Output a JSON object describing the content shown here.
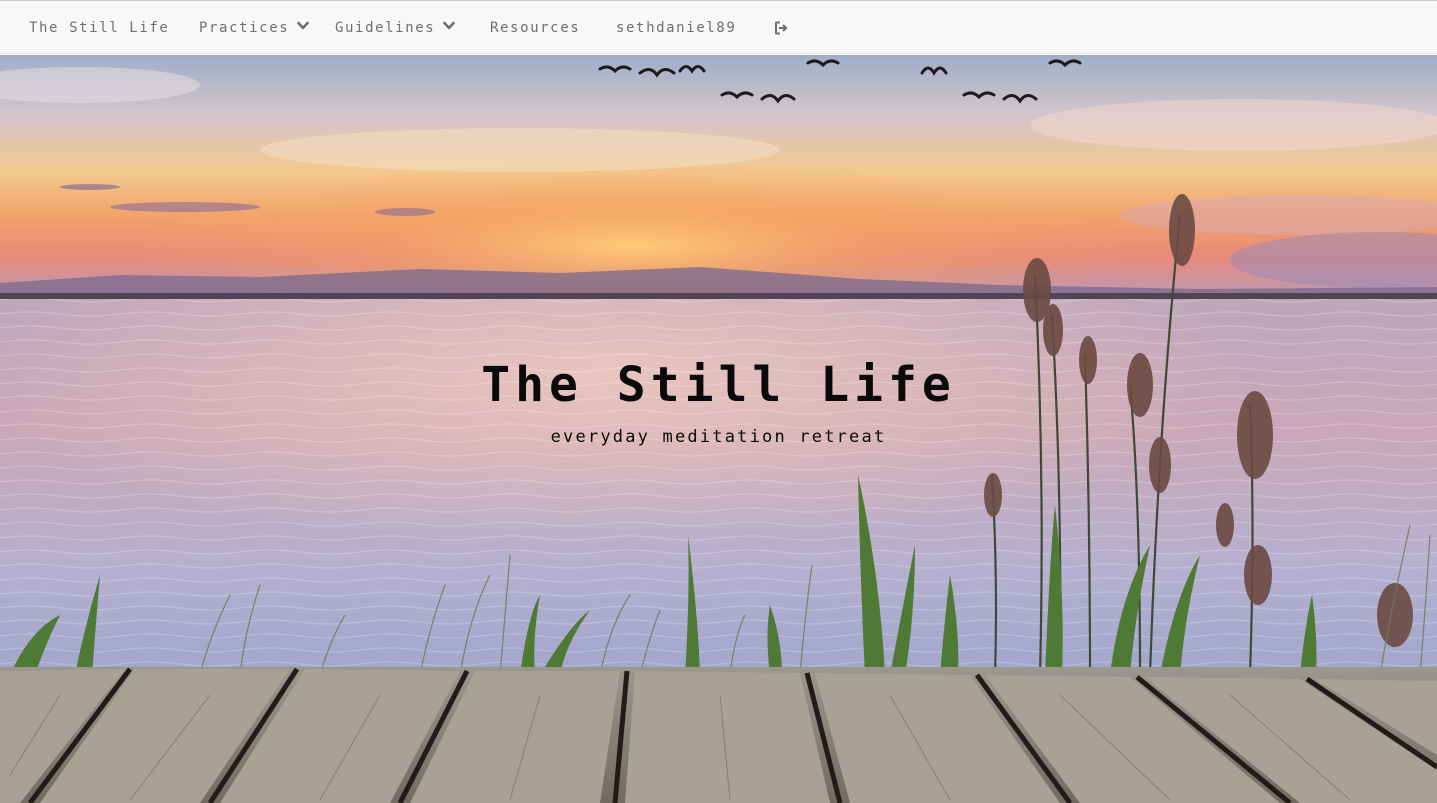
{
  "navbar": {
    "brand": "The Still Life",
    "items": [
      {
        "label": "Practices",
        "has_dropdown": true,
        "icon": "chevron-down-icon"
      },
      {
        "label": "Guidelines",
        "has_dropdown": true,
        "icon": "chevron-down-icon"
      },
      {
        "label": "Resources",
        "has_dropdown": false
      },
      {
        "label": "sethdaniel89",
        "has_dropdown": false
      }
    ],
    "logout_icon": "sign-out-icon"
  },
  "hero": {
    "title": "The Still Life",
    "tagline": "everyday meditation retreat",
    "background": "sunset-lake-with-reeds-and-wooden-dock"
  },
  "colors": {
    "nav_bg": "#f8f8f8",
    "nav_text": "#6f6f6f",
    "hero_text": "#0a0a0a",
    "sky_top": "#9fb0c8",
    "sunset": "#f6a35d",
    "water": "#b9a7c4",
    "dock": "#8a8478"
  }
}
